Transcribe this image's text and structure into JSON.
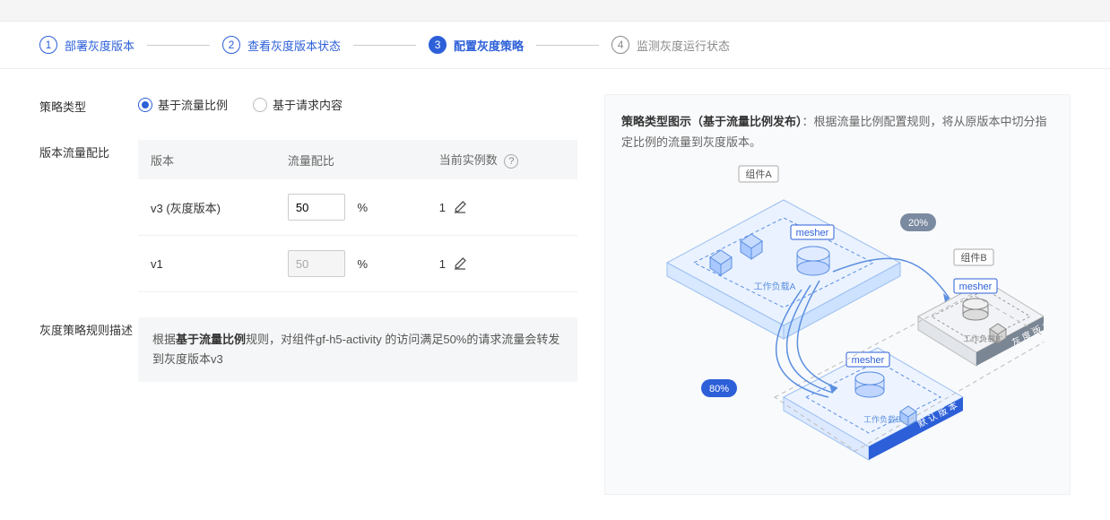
{
  "stepper": {
    "steps": [
      {
        "num": "1",
        "label": "部署灰度版本"
      },
      {
        "num": "2",
        "label": "查看灰度版本状态"
      },
      {
        "num": "3",
        "label": "配置灰度策略"
      },
      {
        "num": "4",
        "label": "监测灰度运行状态"
      }
    ],
    "current_index": 2
  },
  "form": {
    "strategy_type_label": "策略类型",
    "radios": {
      "by_traffic": "基于流量比例",
      "by_request": "基于请求内容"
    },
    "radio_selected": "by_traffic",
    "traffic_label": "版本流量配比",
    "table": {
      "headers": {
        "version": "版本",
        "ratio": "流量配比",
        "instances": "当前实例数"
      },
      "rows": [
        {
          "version": "v3 (灰度版本)",
          "ratio": "50",
          "instances": "1",
          "editable": true
        },
        {
          "version": "v1",
          "ratio": "50",
          "instances": "1",
          "editable": false
        }
      ]
    },
    "desc_label": "灰度策略规则描述",
    "desc_prefix": "根据",
    "desc_bold": "基于流量比例",
    "desc_suffix": "规则，对组件gf-h5-activity 的访问满足50%的请求流量会转发到灰度版本v3"
  },
  "right": {
    "title": "策略类型图示（基于流量比例发布）",
    "desc": "：根据流量比例配置规则，将从原版本中切分指定比例的流量到灰度版本。",
    "diagram": {
      "componentA_label": "组件A",
      "componentB_label": "组件B",
      "mesher_label": "mesher",
      "workloadA_label": "工作负载A",
      "workloadB_label": "工作负载B",
      "workloadB2_label": "工作负载B'",
      "default_version_label": "默 认 版 本",
      "gray_version_label": "灰 度 版 本",
      "pct80": "80%",
      "pct20": "20%"
    }
  },
  "colors": {
    "primary": "#2c5fd8",
    "inactive": "#8a8a8a",
    "bg_panel": "#f9fafc"
  }
}
